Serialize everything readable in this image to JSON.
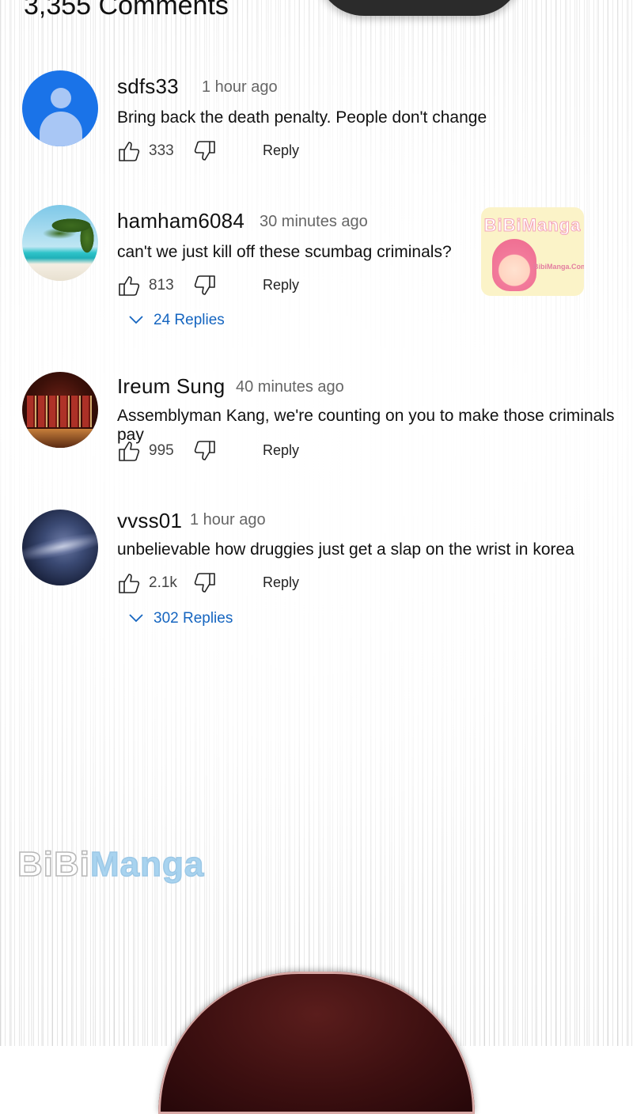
{
  "header": {
    "comment_count": "3,355 Comments"
  },
  "comments": [
    {
      "user": "sdfs33",
      "time": "1 hour ago",
      "text": "Bring back the death penalty. People don't change",
      "likes": "333",
      "reply": "Reply",
      "avatar": "default-user-avatar"
    },
    {
      "user": "hamham6084",
      "time": "30 minutes ago",
      "text": "can't we just kill off these scumbag criminals?",
      "likes": "813",
      "reply": "Reply",
      "replies": "24 Replies",
      "avatar": "palm-beach-avatar"
    },
    {
      "user": "Ireum Sung",
      "time": "40 minutes ago",
      "text": "Assemblyman Kang, we're counting on you to make those criminals pay",
      "likes": "995",
      "reply": "Reply",
      "avatar": "liquor-shelf-avatar"
    },
    {
      "user": "vvss01",
      "time": "1 hour ago",
      "text": "unbelievable how druggies just get a slap on the wrist in korea",
      "likes": "2.1k",
      "reply": "Reply",
      "replies": "302 Replies",
      "avatar": "night-sky-avatar"
    }
  ],
  "ad_badge": {
    "logo": "BiBiManga",
    "site": "BibiManga.Com"
  },
  "watermark": {
    "prefix": "BiBi",
    "suffix": "Manga"
  },
  "icons": {
    "like": "thumbs-up-icon",
    "dislike": "thumbs-down-icon",
    "expand": "chevron-down-icon"
  },
  "colors": {
    "link": "#1565c0",
    "meta": "#666666"
  }
}
